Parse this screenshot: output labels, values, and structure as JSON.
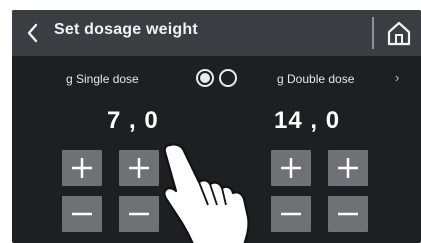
{
  "header": {
    "title": "Set dosage weight",
    "back_icon": "chevron-left-icon",
    "home_icon": "home-icon"
  },
  "single": {
    "label": "g Single dose",
    "value": "7 , 0"
  },
  "double": {
    "label": "g Double dose",
    "value": "14 , 0"
  },
  "radio": {
    "selected_index": 0,
    "count": 2
  },
  "next_arrow": "›",
  "colors": {
    "background": "#1d1f22",
    "header": "#3a3d42",
    "button": "#6e7176",
    "text": "#ffffff"
  }
}
